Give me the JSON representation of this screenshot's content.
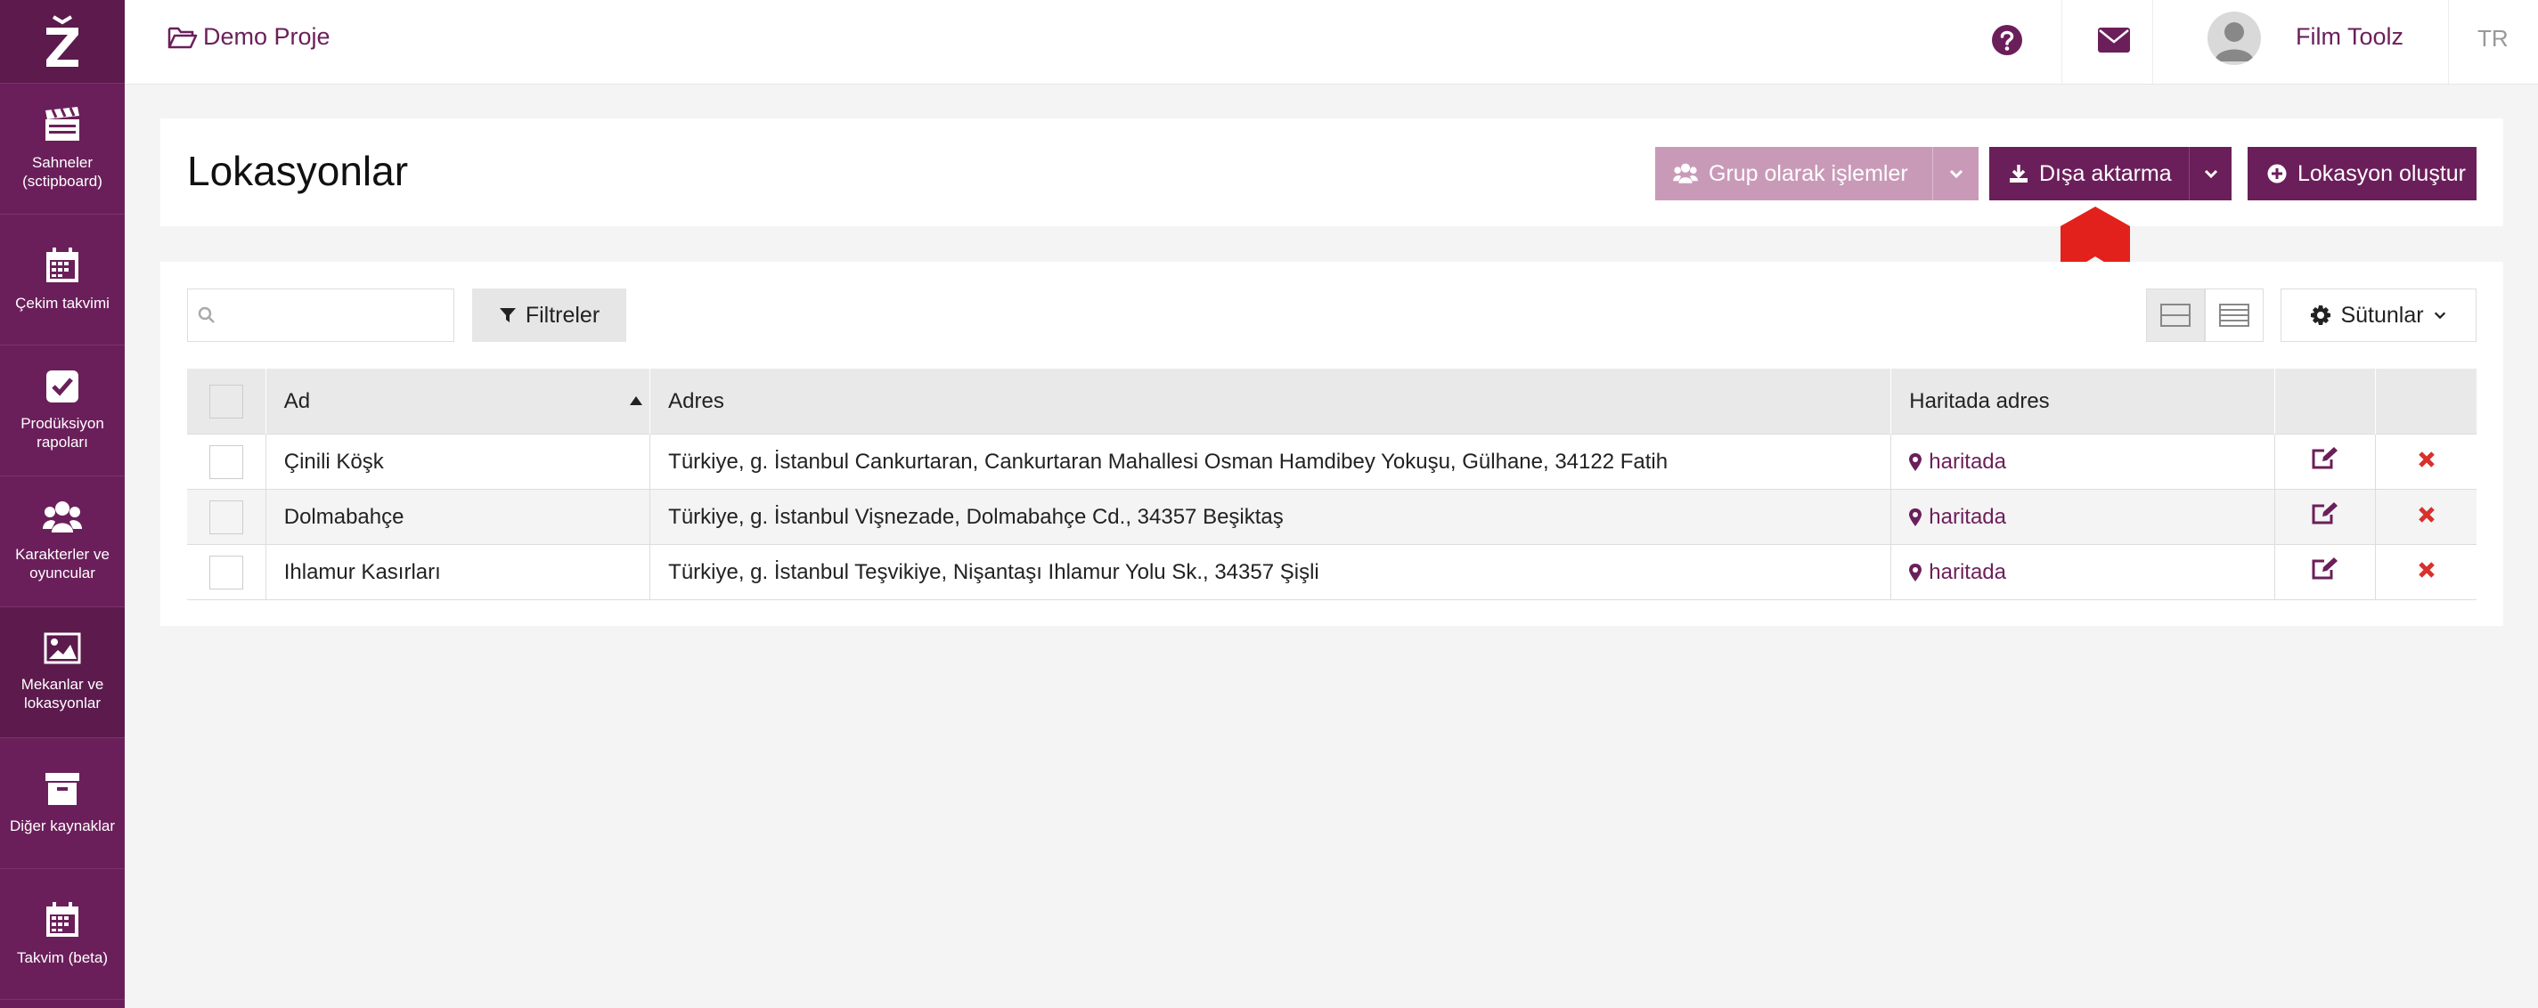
{
  "app": {
    "logo_alt": "Z"
  },
  "sidebar": {
    "items": [
      {
        "label": "Sahneler (sctipboard)",
        "icon": "clapperboard-icon"
      },
      {
        "label": "Çekim takvimi",
        "icon": "calendar-icon"
      },
      {
        "label": "Prodüksiyon rapoları",
        "icon": "checkbox-icon"
      },
      {
        "label": "Karakterler ve oyuncular",
        "icon": "users-icon"
      },
      {
        "label": "Mekanlar ve lokasyonlar",
        "icon": "image-icon"
      },
      {
        "label": "Diğer kaynaklar",
        "icon": "archive-icon"
      },
      {
        "label": "Takvim (beta)",
        "icon": "calendar-icon"
      }
    ]
  },
  "topbar": {
    "project": "Demo Proje",
    "username": "Film Toolz",
    "lang": "TR"
  },
  "page": {
    "title": "Lokasyonlar",
    "bulk_label": "Grup olarak işlemler",
    "export_label": "Dışa aktarma",
    "create_label": "Lokasyon oluştur"
  },
  "toolbar": {
    "search_placeholder": "",
    "filter_label": "Filtreler",
    "columns_label": "Sütunlar"
  },
  "table": {
    "headers": {
      "name": "Ad",
      "address": "Adres",
      "map": "Haritada adres"
    },
    "rows": [
      {
        "name": "Çinili Köşk",
        "address": "Türkiye, g. İstanbul Cankurtaran, Cankurtaran Mahallesi Osman Hamdibey Yokuşu, Gülhane, 34122 Fatih",
        "map": "haritada"
      },
      {
        "name": "Dolmabahçe",
        "address": "Türkiye, g. İstanbul Vişnezade, Dolmabahçe Cd., 34357 Beşiktaş",
        "map": "haritada"
      },
      {
        "name": "Ihlamur Kasırları",
        "address": "Türkiye, g. İstanbul Teşvikiye, Nişantaşı Ihlamur Yolu Sk., 34357 Şişli",
        "map": "haritada"
      }
    ]
  },
  "colors": {
    "brand": "#6b1f5a",
    "brand_light": "#c99ab8",
    "danger": "#d9302c",
    "arrow": "#e3211c"
  }
}
